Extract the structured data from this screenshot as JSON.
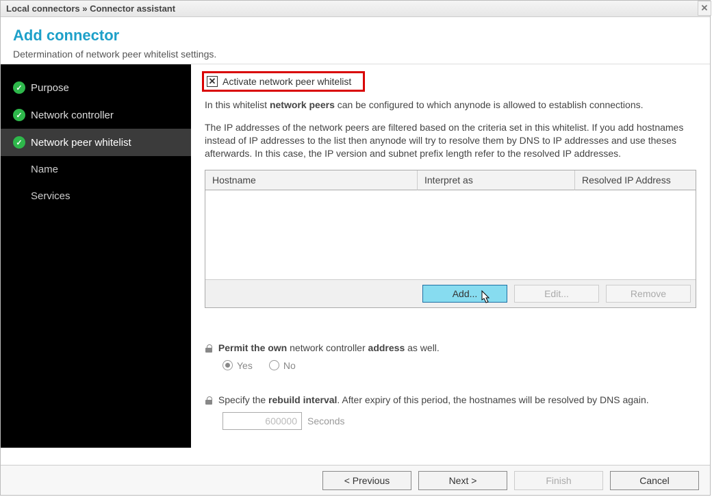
{
  "titlebar": {
    "crumb1": "Local connectors",
    "sep": " » ",
    "crumb2": "Connector assistant"
  },
  "header": {
    "title": "Add connector",
    "subtitle": "Determination of network peer whitelist settings."
  },
  "sidebar": {
    "items": [
      {
        "label": "Purpose",
        "checked": true,
        "active": false
      },
      {
        "label": "Network controller",
        "checked": true,
        "active": false
      },
      {
        "label": "Network peer whitelist",
        "checked": true,
        "active": true
      }
    ],
    "subitems": [
      {
        "label": "Name"
      },
      {
        "label": "Services"
      }
    ]
  },
  "main": {
    "activate_label": "Activate network peer whitelist",
    "activate_checked": true,
    "desc_line1_pre": "In this whitelist ",
    "desc_line1_bold": "network peers",
    "desc_line1_post": " can be configured to which anynode is allowed to establish connections.",
    "desc_para2": "The IP addresses of the network peers are filtered based on the criteria set in this whitelist. If you add hostnames instead of IP addresses to the list then anynode will try to resolve them by DNS to IP addresses and use theses afterwards. In this case, the IP version and subnet prefix length refer to the resolved IP addresses.",
    "table": {
      "cols": [
        "Hostname",
        "Interpret as",
        "Resolved IP Address"
      ],
      "rows": []
    },
    "buttons": {
      "add": "Add...",
      "edit": "Edit...",
      "remove": "Remove"
    },
    "permit": {
      "pre": "Permit the own",
      "mid": " network controller ",
      "bold2": "address",
      "post": " as well.",
      "yes": "Yes",
      "no": "No",
      "selected": "yes"
    },
    "rebuild": {
      "pre": "Specify the ",
      "bold": "rebuild interval",
      "post": ". After expiry of this period, the hostnames will be resolved by DNS again.",
      "value": "600000",
      "unit": "Seconds"
    }
  },
  "footer": {
    "previous": "< Previous",
    "next": "Next >",
    "finish": "Finish",
    "cancel": "Cancel"
  }
}
